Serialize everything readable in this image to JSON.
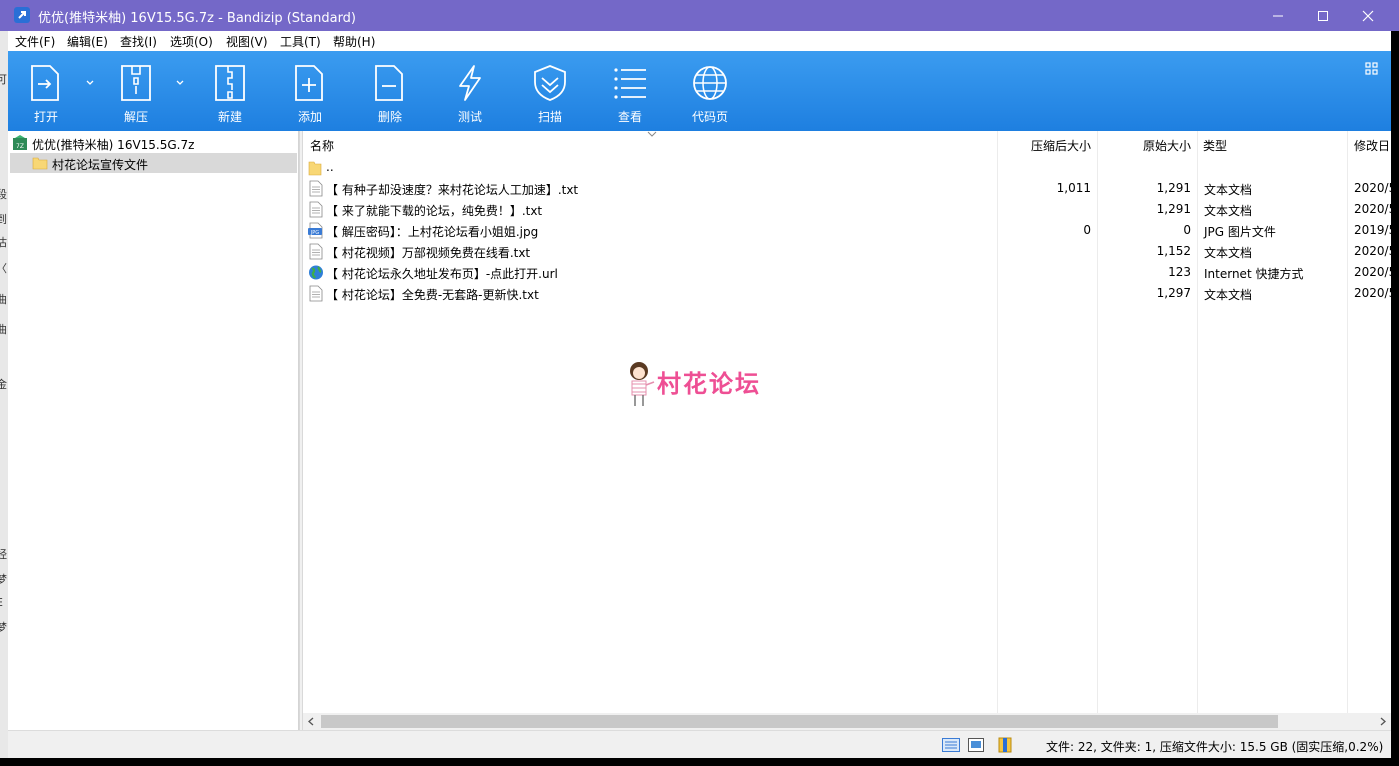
{
  "window": {
    "title": "优优(推特米柚) 16V15.5G.7z - Bandizip (Standard)"
  },
  "menu": [
    "文件(F)",
    "编辑(E)",
    "查找(I)",
    "选项(O)",
    "视图(V)",
    "工具(T)",
    "帮助(H)"
  ],
  "toolbar": {
    "open": "打开",
    "extract": "解压",
    "new": "新建",
    "add": "添加",
    "delete": "删除",
    "test": "测试",
    "scan": "扫描",
    "view": "查看",
    "codepage": "代码页"
  },
  "tree": {
    "root": "优优(推特米柚) 16V15.5G.7z",
    "child": "村花论坛宣传文件"
  },
  "columns": {
    "name": "名称",
    "compressed": "压缩后大小",
    "original": "原始大小",
    "type": "类型",
    "modified": "修改日"
  },
  "rows": [
    {
      "name": "..",
      "compressed": "",
      "original": "",
      "type": "",
      "modified": "",
      "icon": "folder-icon"
    },
    {
      "name": "【 有种子却没速度？来村花论坛人工加速】.txt",
      "compressed": "1,011",
      "original": "1,291",
      "type": "文本文档",
      "modified": "2020/5",
      "icon": "text-file-icon"
    },
    {
      "name": "【 来了就能下载的论坛，纯免费！】.txt",
      "compressed": "",
      "original": "1,291",
      "type": "文本文档",
      "modified": "2020/5",
      "icon": "text-file-icon"
    },
    {
      "name": "【 解压密码】：上村花论坛看小姐姐.jpg",
      "compressed": "0",
      "original": "0",
      "type": "JPG 图片文件",
      "modified": "2019/5",
      "icon": "jpg-file-icon"
    },
    {
      "name": "【 村花视频】万部视频免费在线看.txt",
      "compressed": "",
      "original": "1,152",
      "type": "文本文档",
      "modified": "2020/5",
      "icon": "text-file-icon"
    },
    {
      "name": "【 村花论坛永久地址发布页】-点此打开.url",
      "compressed": "",
      "original": "123",
      "type": "Internet 快捷方式",
      "modified": "2020/5",
      "icon": "globe-icon"
    },
    {
      "name": "【 村花论坛】全免费-无套路-更新快.txt",
      "compressed": "",
      "original": "1,297",
      "type": "文本文档",
      "modified": "2020/5",
      "icon": "text-file-icon"
    }
  ],
  "watermark": "村花论坛",
  "status": {
    "text": "文件: 22, 文件夹: 1, 压缩文件大小: 15.5 GB (固实压缩,0.2%)"
  },
  "colors": {
    "titlebar": "#7468c8",
    "toolbar": "#1e7fe0",
    "watermark": "#ee4f94"
  }
}
